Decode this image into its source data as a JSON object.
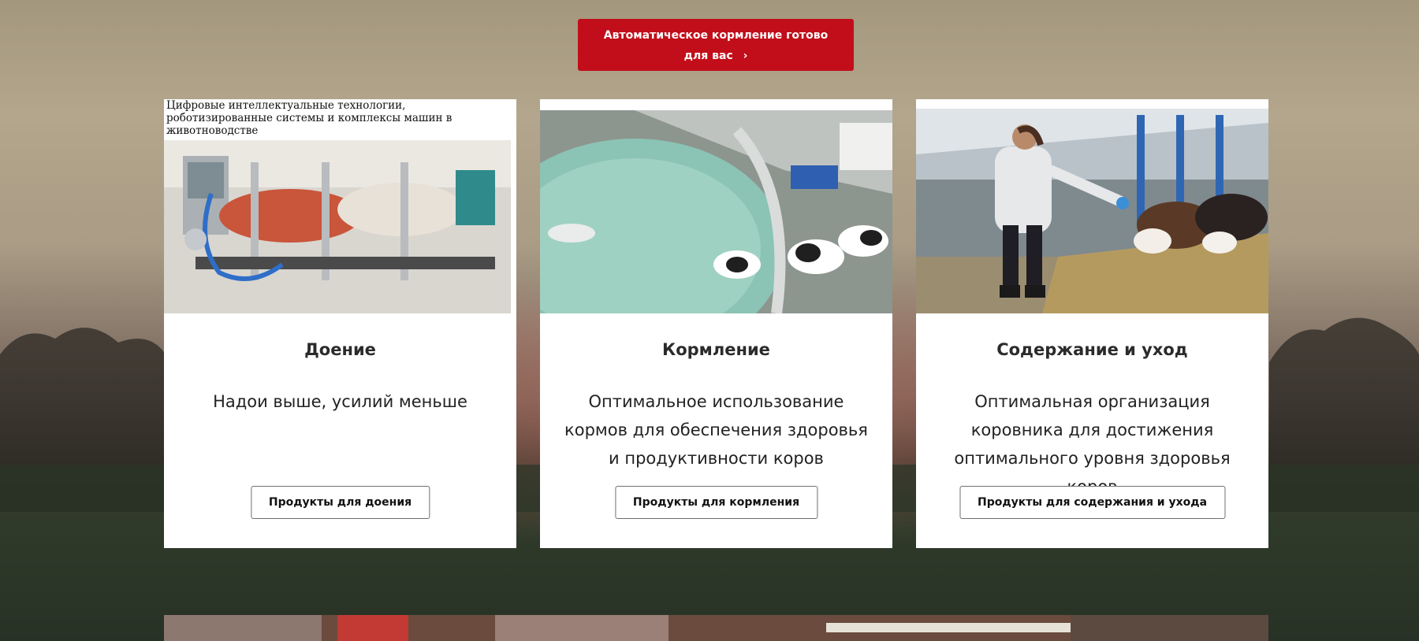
{
  "cta": {
    "label": "Автоматическое кормление готово для вас",
    "chevron": "›",
    "color": "#c20e1a"
  },
  "cards": [
    {
      "title": "Доение",
      "description": "Надои выше, усилий меньше",
      "button_label": "Продукты для доения",
      "image_caption": "Цифровые интеллектуальные технологии, роботизированные системы и комплексы машин в животноводстве",
      "image_icon": "milking-machine-photo"
    },
    {
      "title": "Кормление",
      "description": "Оптимальное использование кормов для обеспечения здоровья и продуктивности коров",
      "button_label": "Продукты для кормления",
      "image_icon": "calf-feeder-photo"
    },
    {
      "title": "Содержание и уход",
      "description": "Оптимальная организация коровника для достижения оптимального уровня здоровья коров",
      "button_label": "Продукты для содержания и ухода",
      "image_icon": "barn-care-photo"
    }
  ],
  "bottom_section": {
    "image_icon": "barn-interior-photo"
  }
}
